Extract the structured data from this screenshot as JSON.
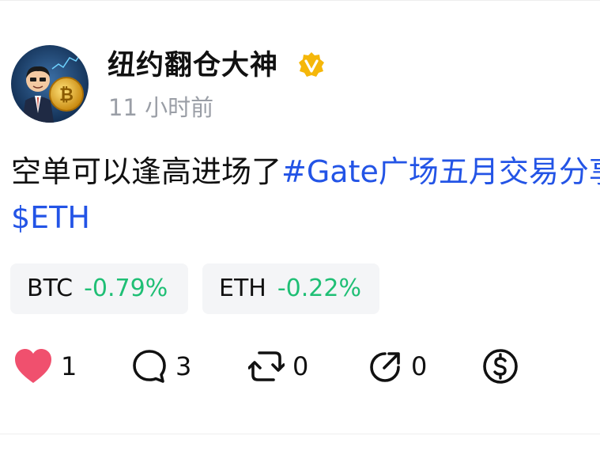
{
  "post": {
    "author": {
      "name": "纽约翻仓大神",
      "verified_icon": "verified-v-badge-icon",
      "avatar_icon": "cartoon-businessman-bitcoin-avatar"
    },
    "time": "11 小时前",
    "text": {
      "plain": "空单可以逢高进场了",
      "hashtag": "#Gate广场五月交易分享",
      "cashtag": "$ETH"
    },
    "tickers": [
      {
        "symbol": "BTC",
        "change": "-0.79%"
      },
      {
        "symbol": "ETH",
        "change": "-0.22%"
      }
    ],
    "actions": {
      "likes": "1",
      "comments": "3",
      "reposts": "0",
      "shares": "0"
    }
  },
  "colors": {
    "hashtag": "#2354e6",
    "change": "#1fbf75",
    "like": "#f0506e",
    "verified": "#f5b70a",
    "muted": "#9a9ea6",
    "chip_bg": "#f4f5f7"
  }
}
